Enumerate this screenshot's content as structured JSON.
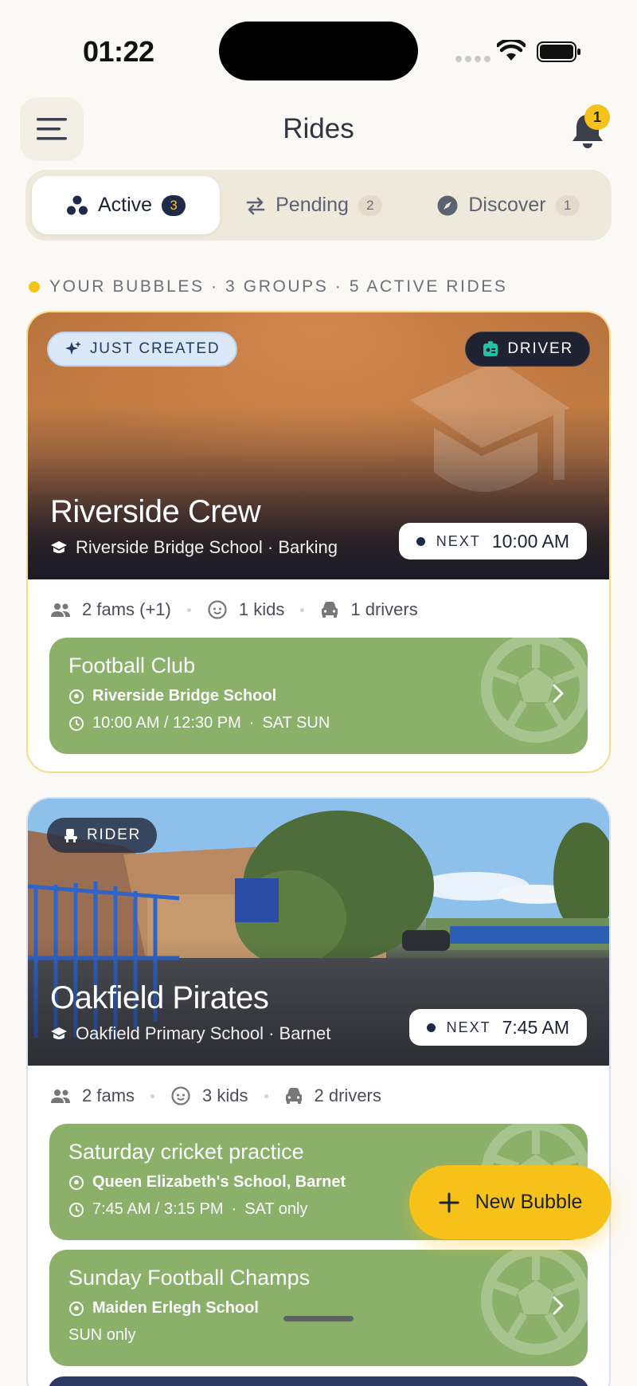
{
  "status_bar": {
    "time": "01:22"
  },
  "header": {
    "title": "Rides",
    "notifications_count": "1"
  },
  "tabs": [
    {
      "label": "Active",
      "count": "3",
      "icon": "bubbles-icon",
      "active": true
    },
    {
      "label": "Pending",
      "count": "2",
      "icon": "swap-icon",
      "active": false
    },
    {
      "label": "Discover",
      "count": "1",
      "icon": "compass-icon",
      "active": false
    }
  ],
  "section_label": "YOUR BUBBLES · 3 GROUPS · 5 ACTIVE RIDES",
  "bubbles": [
    {
      "badge": "JUST CREATED",
      "role": "DRIVER",
      "name": "Riverside Crew",
      "school": "Riverside Bridge School · Barking",
      "next_label": "NEXT",
      "next_time": "10:00 AM",
      "stats": {
        "fams": "2 fams (+1)",
        "kids": "1 kids",
        "drivers": "1 drivers"
      },
      "rides": [
        {
          "title": "Football Club",
          "location": "Riverside Bridge School",
          "times": "10:00 AM / 12:30 PM",
          "days": "SAT SUN"
        }
      ]
    },
    {
      "role": "RIDER",
      "name": "Oakfield Pirates",
      "school": "Oakfield Primary School · Barnet",
      "next_label": "NEXT",
      "next_time": "7:45 AM",
      "stats": {
        "fams": "2 fams",
        "kids": "3 kids",
        "drivers": "2 drivers"
      },
      "rides": [
        {
          "title": "Saturday cricket practice",
          "location": "Queen Elizabeth's School, Barnet",
          "times": "7:45 AM / 3:15 PM",
          "days": "SAT only"
        },
        {
          "title": "Sunday Football Champs",
          "location": "Maiden Erlegh School",
          "days": "SUN only"
        }
      ]
    }
  ],
  "fab": {
    "label": "New Bubble"
  },
  "colors": {
    "accent": "#f6c21a",
    "navy": "#1e2a4a",
    "ride_green": "#8ab06a",
    "background": "#fbf9f5"
  }
}
